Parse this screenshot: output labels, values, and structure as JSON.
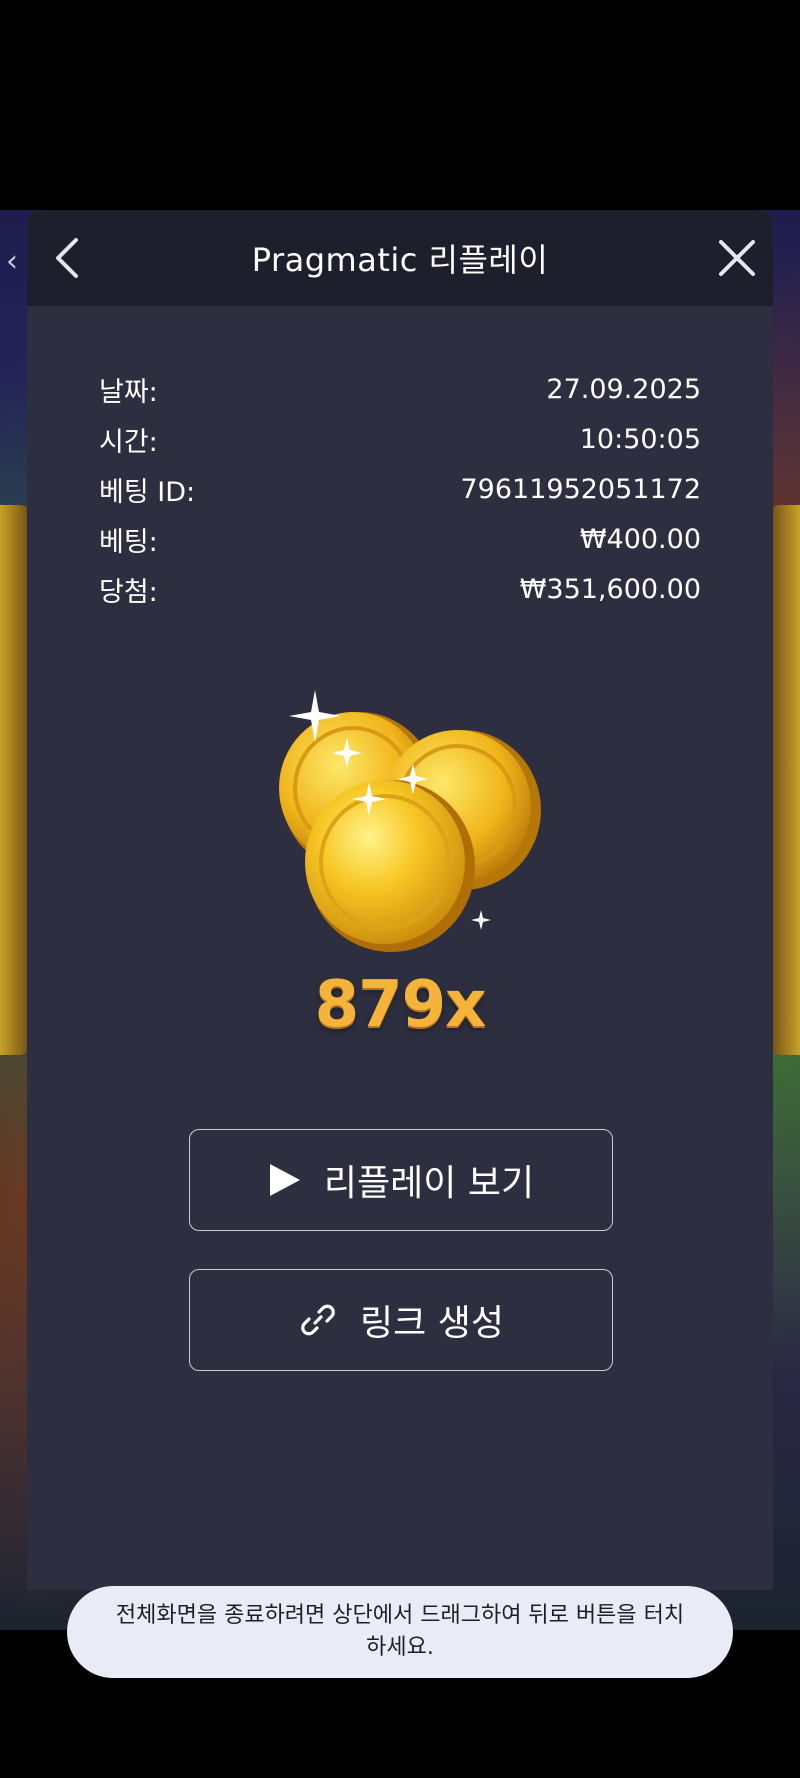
{
  "header": {
    "title": "Pragmatic 리플레이",
    "back_icon": "chevron-left-icon",
    "close_icon": "close-icon"
  },
  "info": {
    "rows": [
      {
        "label": "날짜:",
        "value": "27.09.2025"
      },
      {
        "label": "시간:",
        "value": "10:50:05"
      },
      {
        "label": "베팅 ID:",
        "value": "79611952051172"
      },
      {
        "label": "베팅:",
        "value": "₩400.00"
      },
      {
        "label": "당첨:",
        "value": "₩351,600.00"
      }
    ]
  },
  "win": {
    "icon": "gold-coins-icon",
    "multiplier": "879x"
  },
  "actions": {
    "replay_label": "리플레이 보기",
    "replay_icon": "play-icon",
    "link_label": "링크 생성",
    "link_icon": "link-icon"
  },
  "toast": {
    "text": "전체화면을 종료하려면 상단에서 드래그하여 뒤로 버튼을 터치하세요."
  },
  "colors": {
    "modal_bg": "#2d2f40",
    "header_bg": "#1d1f2c",
    "multiplier": "#f5b33a",
    "toast_bg": "#e9ecf6"
  }
}
